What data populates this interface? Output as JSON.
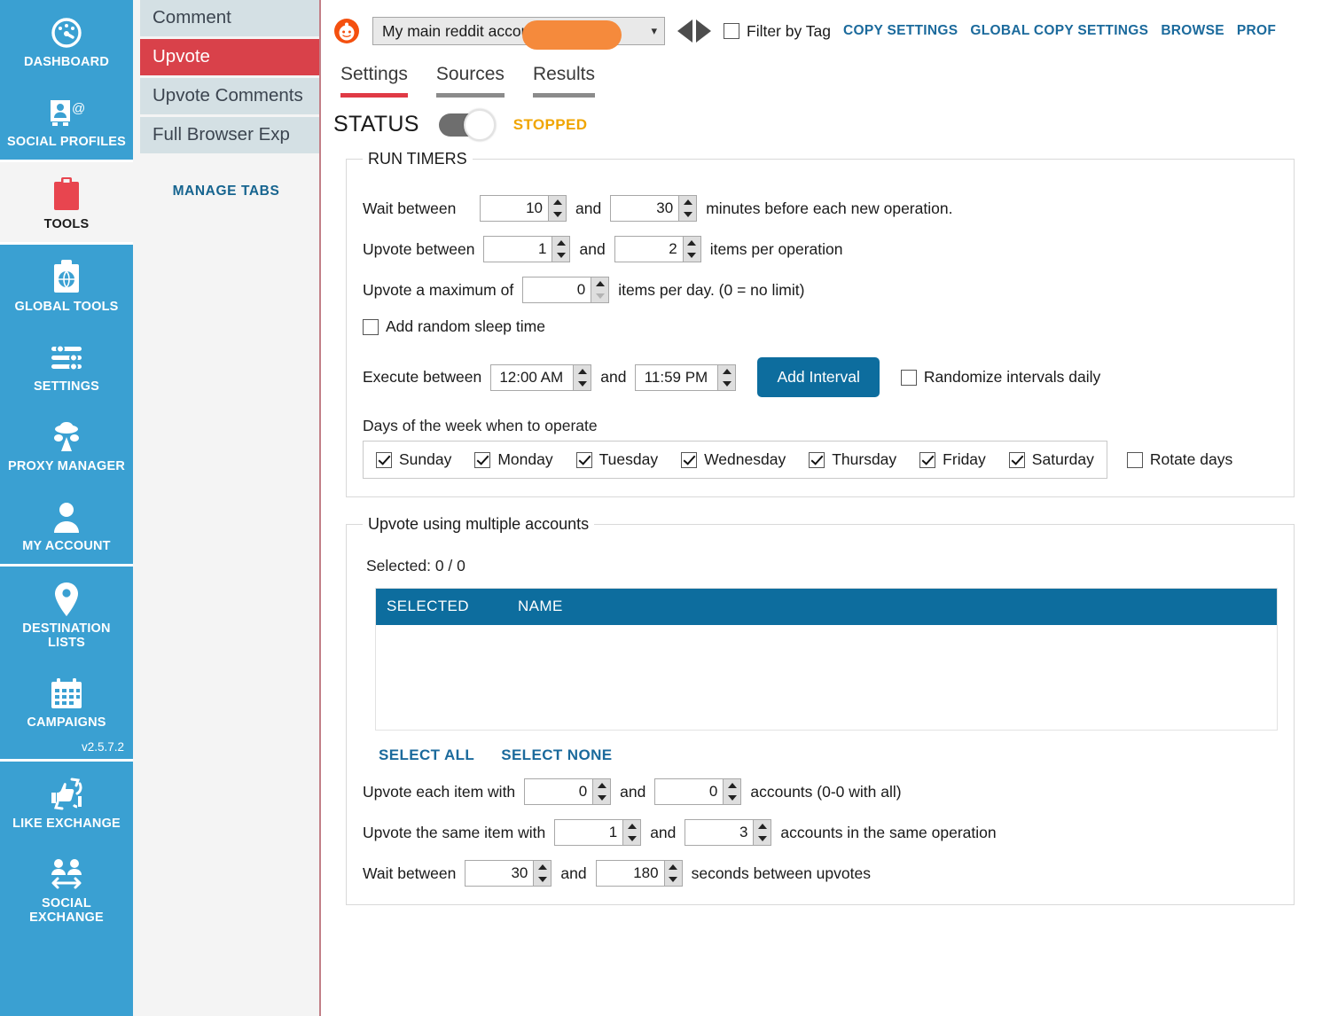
{
  "rail": {
    "groups": [
      {
        "items": [
          {
            "label": "DASHBOARD",
            "icon": "dashboard-icon",
            "active": false
          },
          {
            "label": "SOCIAL PROFILES",
            "icon": "social-profiles-icon",
            "active": false
          }
        ]
      },
      {
        "items": [
          {
            "label": "TOOLS",
            "icon": "tools-clipboard-icon",
            "active": true
          }
        ]
      },
      {
        "items": [
          {
            "label": "GLOBAL TOOLS",
            "icon": "global-tools-icon",
            "active": false
          },
          {
            "label": "SETTINGS",
            "icon": "sliders-icon",
            "active": false
          },
          {
            "label": "PROXY MANAGER",
            "icon": "spy-icon",
            "active": false
          },
          {
            "label": "MY ACCOUNT",
            "icon": "user-icon",
            "active": false
          }
        ]
      },
      {
        "items": [
          {
            "label": "DESTINATION LISTS",
            "icon": "map-pin-icon",
            "active": false
          },
          {
            "label": "CAMPAIGNS",
            "icon": "calendar-icon",
            "active": false
          }
        ]
      },
      {
        "items": [
          {
            "label": "LIKE EXCHANGE",
            "icon": "thumbs-exchange-icon",
            "active": false
          },
          {
            "label": "SOCIAL EXCHANGE",
            "icon": "people-exchange-icon",
            "active": false
          }
        ]
      }
    ],
    "version": "v2.5.7.2"
  },
  "tab_column": {
    "items": [
      {
        "label": "Comment",
        "active": false
      },
      {
        "label": "Upvote",
        "active": true
      },
      {
        "label": "Upvote Comments",
        "active": false
      },
      {
        "label": "Full Browser Exp",
        "active": false
      }
    ],
    "manage_tabs_label": "MANAGE TABS"
  },
  "topbar": {
    "account_logo": "reddit-icon",
    "account_value": "My main reddit account - ",
    "account_redacted": true,
    "prev_label": "prev-arrow",
    "next_label": "next-arrow",
    "filter_by_tag": {
      "label": "Filter by Tag",
      "checked": false
    },
    "links": [
      "COPY SETTINGS",
      "GLOBAL COPY SETTINGS",
      "BROWSE",
      "PROF"
    ]
  },
  "tabs": [
    {
      "label": "Settings",
      "active": true
    },
    {
      "label": "Sources",
      "active": false
    },
    {
      "label": "Results",
      "active": false
    }
  ],
  "status": {
    "label": "STATUS",
    "value": "STOPPED",
    "toggle_on": false,
    "color": "#f0a500"
  },
  "run_timers": {
    "legend": "RUN TIMERS",
    "wait": {
      "prefix": "Wait between",
      "min": "10",
      "mid": "and",
      "max": "30",
      "suffix": "minutes before each new operation."
    },
    "upvote_between": {
      "prefix": "Upvote between",
      "min": "1",
      "mid": "and",
      "max": "2",
      "suffix": "items per operation"
    },
    "max_per_day": {
      "prefix": "Upvote a maximum of",
      "value": "0",
      "suffix": "items per day. (0 = no limit)"
    },
    "random_sleep": {
      "label": "Add random sleep time",
      "checked": false
    },
    "execute": {
      "prefix": "Execute between",
      "from": "12:00 AM",
      "mid": "and",
      "to": "11:59 PM",
      "add_interval_label": "Add Interval",
      "randomize": {
        "label": "Randomize intervals daily",
        "checked": false
      }
    },
    "days_title": "Days of the week when to operate",
    "days": [
      {
        "label": "Sunday",
        "checked": true
      },
      {
        "label": "Monday",
        "checked": true
      },
      {
        "label": "Tuesday",
        "checked": true
      },
      {
        "label": "Wednesday",
        "checked": true
      },
      {
        "label": "Thursday",
        "checked": true
      },
      {
        "label": "Friday",
        "checked": true
      },
      {
        "label": "Saturday",
        "checked": true
      }
    ],
    "rotate_days": {
      "label": "Rotate days",
      "checked": false
    }
  },
  "multi_accounts": {
    "legend": "Upvote using multiple accounts",
    "selected_text": "Selected:  0 / 0",
    "table": {
      "columns": [
        "SELECTED",
        "NAME"
      ],
      "rows": []
    },
    "select_all_label": "SELECT ALL",
    "select_none_label": "SELECT NONE",
    "each_item": {
      "prefix": "Upvote each item with",
      "min": "0",
      "mid": "and",
      "max": "0",
      "suffix": "accounts (0-0 with all)"
    },
    "same_item": {
      "prefix": "Upvote the same item with",
      "min": "1",
      "mid": "and",
      "max": "3",
      "suffix": "accounts in the same operation"
    },
    "wait_between": {
      "prefix": "Wait between",
      "min": "30",
      "mid": "and",
      "max": "180",
      "suffix": "seconds between upvotes"
    }
  },
  "colors": {
    "rail_blue": "#3aa0d2",
    "active_red": "#d9414a",
    "link_blue": "#1b6a9c",
    "table_header_blue": "#0d6d9e",
    "status_orange": "#f0a500",
    "redaction_orange": "#f58a3c"
  }
}
